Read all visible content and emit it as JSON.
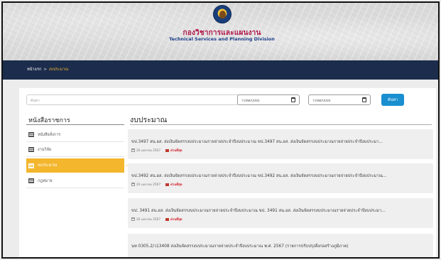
{
  "header": {
    "org_th": "กองวิชาการและแผนงาน",
    "org_en": "Technical Services and Planning Division"
  },
  "breadcrumb": {
    "home": "หน้าแรก",
    "separator": ">",
    "current": "งบประมาณ"
  },
  "filters": {
    "search_placeholder": "ค้นหา",
    "date_from_placeholder": "วว/ดด/ปปปป",
    "date_to_placeholder": "วว/ดด/ปปปป",
    "search_button": "ค้นหา"
  },
  "sidebar": {
    "title": "หนังสือราชการ",
    "items": [
      {
        "label": "หนังสือสั่งการ",
        "active": false
      },
      {
        "label": "งานวิจัย",
        "active": false
      },
      {
        "label": "งบประมาณ",
        "active": true
      },
      {
        "label": "กฎหมาย",
        "active": false
      }
    ]
  },
  "main": {
    "title": "งบประมาณ",
    "items": [
      {
        "title": "ขป.3497 สน.อส. ส่งเงินจัดสรรงบประมาณรายจ่ายประจำปีงบประมาณ ขป.3497 สน.อส. ส่งเงินจัดสรรงบประมาณรายจ่ายประจำปีงบประมา...",
        "date": "26 เมษายน 2567",
        "priority": "ด่วนที่สุด"
      },
      {
        "title": "ขป.3492 สน.อส. ส่งเงินจัดสรรงบประมาณรายจ่ายประจำปีงบประมาณ ขป.3492 สน.อส. ส่งเงินจัดสรรงบประมาณรายจ่ายประจำปีงบประมาณ...",
        "date": "26 เมษายน 2567",
        "priority": "ด่วนที่สุด"
      },
      {
        "title": "ขป. 3491 สน.อส. ส่งเงินจัดสรรงบประมาณรายจ่ายประจำปีงบประมาณ ขป. 3491 สน.อส. ส่งเงินจัดสรรงบประมาณรายจ่ายประจำปีงบประมา...",
        "date": "26 เมษายน 2567",
        "priority": "ด่วนที่สุด"
      },
      {
        "title": "นท 0305.2/ว13408 ส่งเงินจัดสรรงบประมาณรายจ่ายประจำปีงบประมาณ พ.ศ. 2567 (รายการปรับปรุงสิ่งก่อสร้างภูมิภาค)",
        "date": "",
        "priority": ""
      }
    ]
  },
  "colors": {
    "nav_bar": "#1c2c4c",
    "accent": "#f3b62d",
    "button": "#1a8fd0",
    "urgent": "#d0202a"
  }
}
